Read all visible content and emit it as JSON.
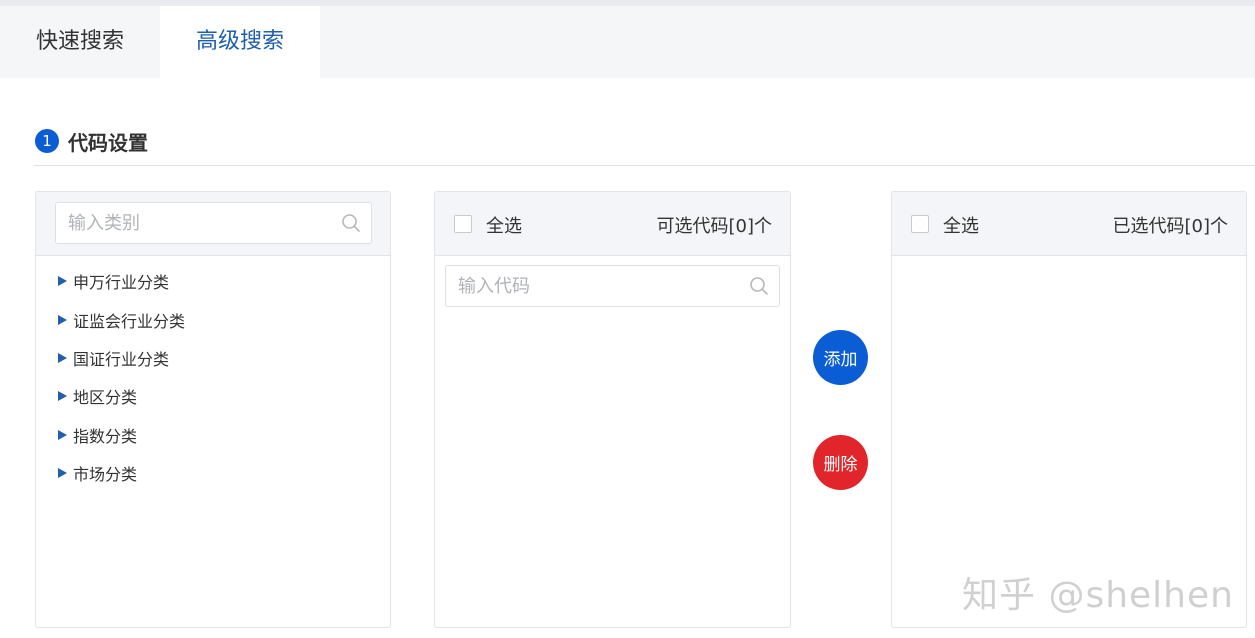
{
  "tabs": [
    {
      "label": "快速搜索"
    },
    {
      "label": "高级搜索"
    }
  ],
  "section": {
    "number": "1",
    "title": "代码设置"
  },
  "category_panel": {
    "search_placeholder": "输入类别",
    "items": [
      {
        "label": "申万行业分类"
      },
      {
        "label": "证监会行业分类"
      },
      {
        "label": "国证行业分类"
      },
      {
        "label": "地区分类"
      },
      {
        "label": "指数分类"
      },
      {
        "label": "市场分类"
      }
    ]
  },
  "available_panel": {
    "select_all_label": "全选",
    "count_text": "可选代码[0]个",
    "search_placeholder": "输入代码"
  },
  "actions": {
    "add_label": "添加",
    "delete_label": "删除"
  },
  "selected_panel": {
    "select_all_label": "全选",
    "count_text": "已选代码[0]个"
  },
  "watermark": "知乎 @shelhen",
  "colors": {
    "accent": "#0b5dd6",
    "danger": "#e1252b",
    "active_tab_text": "#1f5fad"
  }
}
